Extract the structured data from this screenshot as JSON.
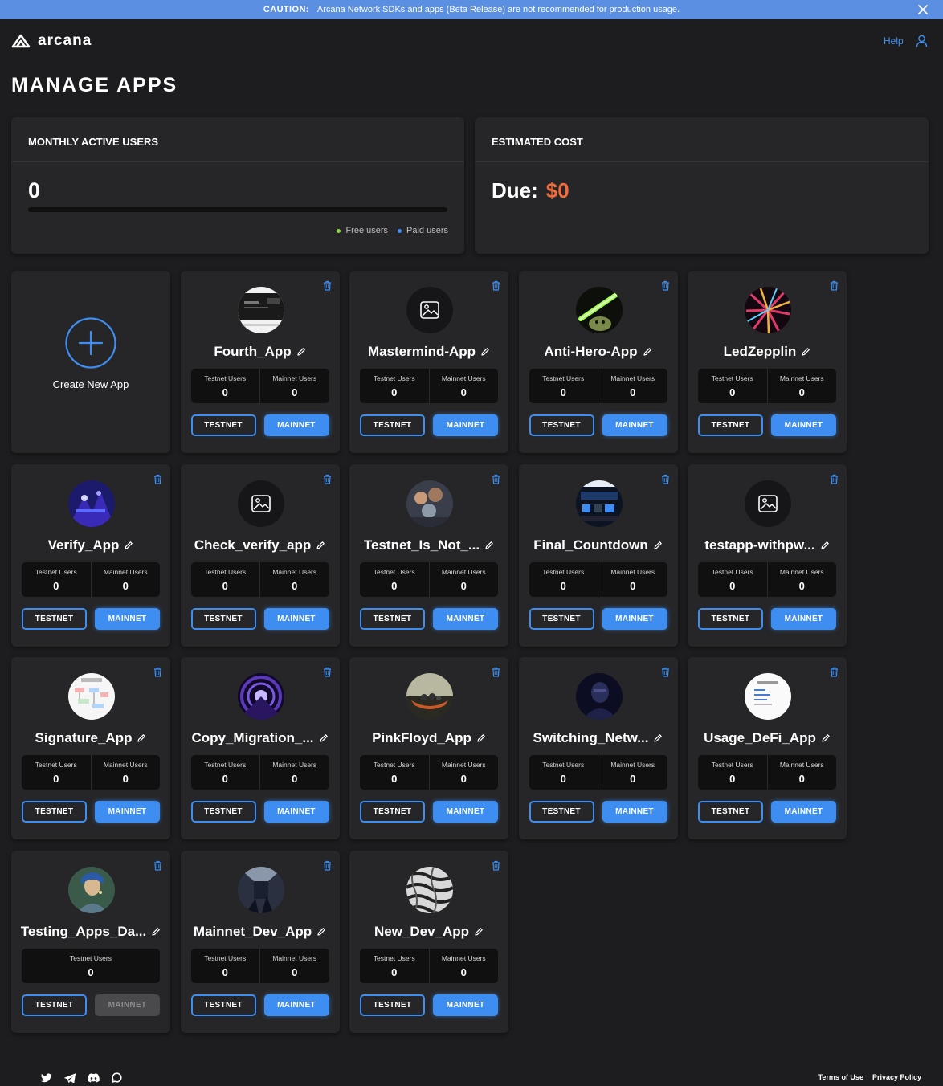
{
  "banner": {
    "caution_label": "CAUTION:",
    "message": "Arcana Network SDKs and apps (Beta Release) are not recommended for production usage."
  },
  "header": {
    "logo_text": "arcana",
    "help_label": "Help"
  },
  "page_title": "MANAGE APPS",
  "mau_card": {
    "title": "MONTHLY ACTIVE USERS",
    "value": "0",
    "legend": [
      {
        "label": "Free users",
        "color": "#8bdc3a"
      },
      {
        "label": "Paid users",
        "color": "#3d8ef0"
      }
    ]
  },
  "cost_card": {
    "title": "ESTIMATED COST",
    "due_label": "Due:",
    "amount": "$0"
  },
  "create_app": {
    "label": "Create New App"
  },
  "users_labels": {
    "testnet": "Testnet Users",
    "mainnet": "Mainnet Users"
  },
  "buttons": {
    "testnet": "TESTNET",
    "mainnet": "MAINNET"
  },
  "apps": [
    {
      "name": "Fourth_App",
      "avatar": "screenshot",
      "testnet_users": "0",
      "mainnet_users": "0",
      "mainnet_enabled": true
    },
    {
      "name": "Mastermind-App",
      "avatar": "placeholder",
      "testnet_users": "0",
      "mainnet_users": "0",
      "mainnet_enabled": true
    },
    {
      "name": "Anti-Hero-App",
      "avatar": "yoda",
      "testnet_users": "0",
      "mainnet_users": "0",
      "mainnet_enabled": true
    },
    {
      "name": "LedZepplin",
      "avatar": "lights",
      "testnet_users": "0",
      "mainnet_users": "0",
      "mainnet_enabled": true
    },
    {
      "name": "Verify_App",
      "avatar": "concert",
      "testnet_users": "0",
      "mainnet_users": "0",
      "mainnet_enabled": true
    },
    {
      "name": "Check_verify_app",
      "avatar": "placeholder",
      "testnet_users": "0",
      "mainnet_users": "0",
      "mainnet_enabled": true
    },
    {
      "name": "Testnet_Is_Not_...",
      "avatar": "people",
      "testnet_users": "0",
      "mainnet_users": "0",
      "mainnet_enabled": true
    },
    {
      "name": "Final_Countdown",
      "avatar": "dashboard",
      "testnet_users": "0",
      "mainnet_users": "0",
      "mainnet_enabled": true
    },
    {
      "name": "testapp-withpw...",
      "avatar": "placeholder",
      "testnet_users": "0",
      "mainnet_users": "0",
      "mainnet_enabled": true
    },
    {
      "name": "Signature_App",
      "avatar": "diagram",
      "testnet_users": "0",
      "mainnet_users": "0",
      "mainnet_enabled": true
    },
    {
      "name": "Copy_Migration_...",
      "avatar": "tunnel",
      "testnet_users": "0",
      "mainnet_users": "0",
      "mainnet_enabled": true
    },
    {
      "name": "PinkFloyd_App",
      "avatar": "boat",
      "testnet_users": "0",
      "mainnet_users": "0",
      "mainnet_enabled": true
    },
    {
      "name": "Switching_Netw...",
      "avatar": "portrait",
      "testnet_users": "0",
      "mainnet_users": "0",
      "mainnet_enabled": true
    },
    {
      "name": "Usage_DeFi_App",
      "avatar": "document",
      "testnet_users": "0",
      "mainnet_users": "0",
      "mainnet_enabled": true
    },
    {
      "name": "Testing_Apps_Da...",
      "avatar": "painting",
      "testnet_users": "0",
      "mainnet_users": null,
      "mainnet_enabled": false
    },
    {
      "name": "Mainnet_Dev_App",
      "avatar": "room",
      "testnet_users": "0",
      "mainnet_users": "0",
      "mainnet_enabled": true
    },
    {
      "name": "New_Dev_App",
      "avatar": "pattern",
      "testnet_users": "0",
      "mainnet_users": "0",
      "mainnet_enabled": true
    }
  ],
  "footer": {
    "social_icons": [
      "twitter-icon",
      "telegram-icon",
      "discord-icon",
      "chat-icon"
    ],
    "links": [
      "Terms of Use",
      "Privacy Policy"
    ]
  }
}
